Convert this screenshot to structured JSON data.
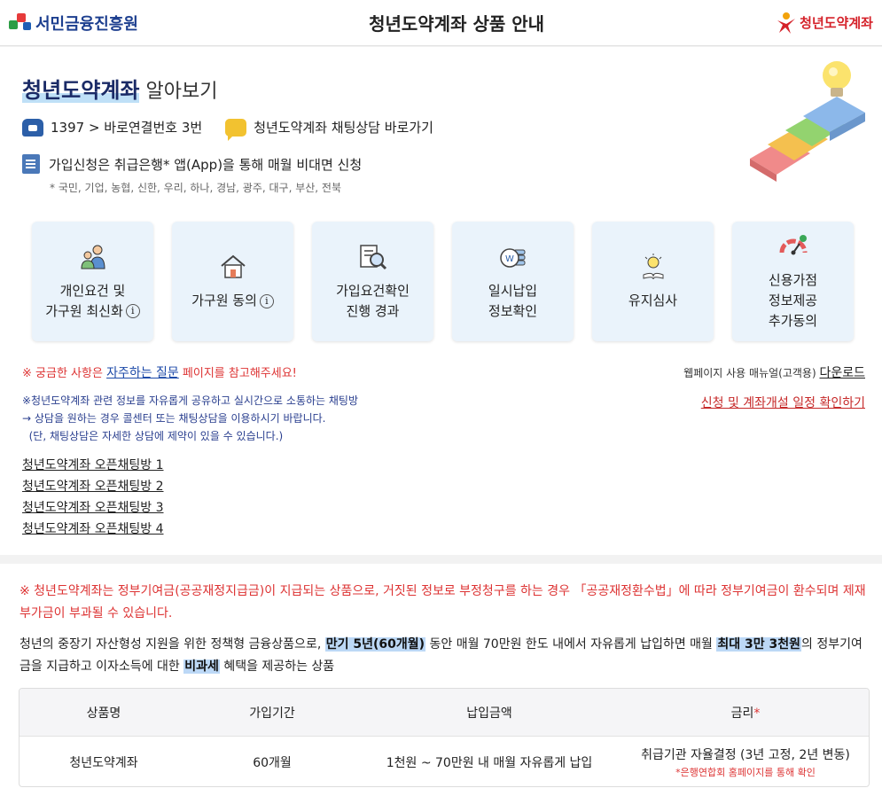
{
  "header": {
    "left_logo": "서민금융진흥원",
    "title": "청년도약계좌 상품 안내",
    "right_logo": "청년도약계좌"
  },
  "intro": {
    "title_bold": "청년도약계좌",
    "title_rest": " 알아보기",
    "phone": "1397 > 바로연결번호 3번",
    "chat": "청년도약계좌 채팅상담 바로가기",
    "apply": "가입신청은 취급은행* 앱(App)을 통해 매월 비대면 신청",
    "banks": "* 국민, 기업, 농협, 신한, 우리, 하나, 경남, 광주, 대구, 부산, 전북"
  },
  "tiles": [
    {
      "label": "개인요건 및\n가구원 최신화",
      "info": "i",
      "icon": "family-icon"
    },
    {
      "label": "가구원 동의",
      "info": "i",
      "icon": "house-icon"
    },
    {
      "label": "가입요건확인\n진행 경과",
      "info": "",
      "icon": "document-search-icon"
    },
    {
      "label": "일시납입\n정보확인",
      "info": "",
      "icon": "coin-icon"
    },
    {
      "label": "유지심사",
      "info": "",
      "icon": "lightbulb-book-icon"
    },
    {
      "label": "신용가점\n정보제공\n추가동의",
      "info": "",
      "icon": "gauge-icon"
    }
  ],
  "links": {
    "faq_prefix": "※ 궁금한 사항은 ",
    "faq_link": "자주하는 질문",
    "faq_suffix": " 페이지를 참고해주세요!",
    "manual_prefix": "웹페이지 사용 매뉴얼(고객용) ",
    "manual_link": "다운로드",
    "schedule": "신청 및 계좌개설 일정 확인하기"
  },
  "chat_note": [
    "※청년도약계좌 관련 정보를 자유롭게 공유하고 실시간으로 소통하는 채팅방",
    "→ 상담을 원하는 경우 콜센터 또는 채팅상담을 이용하시기 바랍니다.",
    "  (단, 채팅상담은 자세한 상담에 제약이 있을 수 있습니다.)"
  ],
  "openchat": [
    "청년도약계좌 오픈채팅방 1",
    "청년도약계좌 오픈채팅방 2",
    "청년도약계좌 오픈채팅방 3",
    "청년도약계좌 오픈채팅방 4"
  ],
  "notice": {
    "warning": "※ 청년도약계좌는 정부기여금(공공재정지급금)이 지급되는 상품으로, 거짓된 정보로 부정청구를 하는 경우 「공공재정환수법」에 따라 정부기여금이 환수되며 제재부가금이 부과될 수 있습니다.",
    "desc_1": "청년의 중장기 자산형성 지원을 위한 정책형 금융상품으로, ",
    "desc_hl1": "만기 5년(60개월)",
    "desc_2": " 동안 매월 70만원 한도 내에서 자유롭게 납입하면 매월 ",
    "desc_hl2": "최대 3만 3천원",
    "desc_3": "의 정부기여금을 지급하고 이자소득에 대한 ",
    "desc_hl3": "비과세",
    "desc_4": " 혜택을 제공하는 상품"
  },
  "table": {
    "headers": [
      "상품명",
      "가입기간",
      "납입금액",
      "금리"
    ],
    "required_mark": "*",
    "row": [
      "청년도약계좌",
      "60개월",
      "1천원 ~ 70만원 내 매월 자유롭게 납입",
      "취급기관 자율결정 (3년 고정, 2년 변동)"
    ],
    "rate_note": "*은행연합회 홈페이지를 통해 확인"
  },
  "colors": {
    "navy": "#1a2a66",
    "tile_bg": "#eaf3fb",
    "warning_red": "#d33",
    "highlight": "#bcd8f6"
  }
}
